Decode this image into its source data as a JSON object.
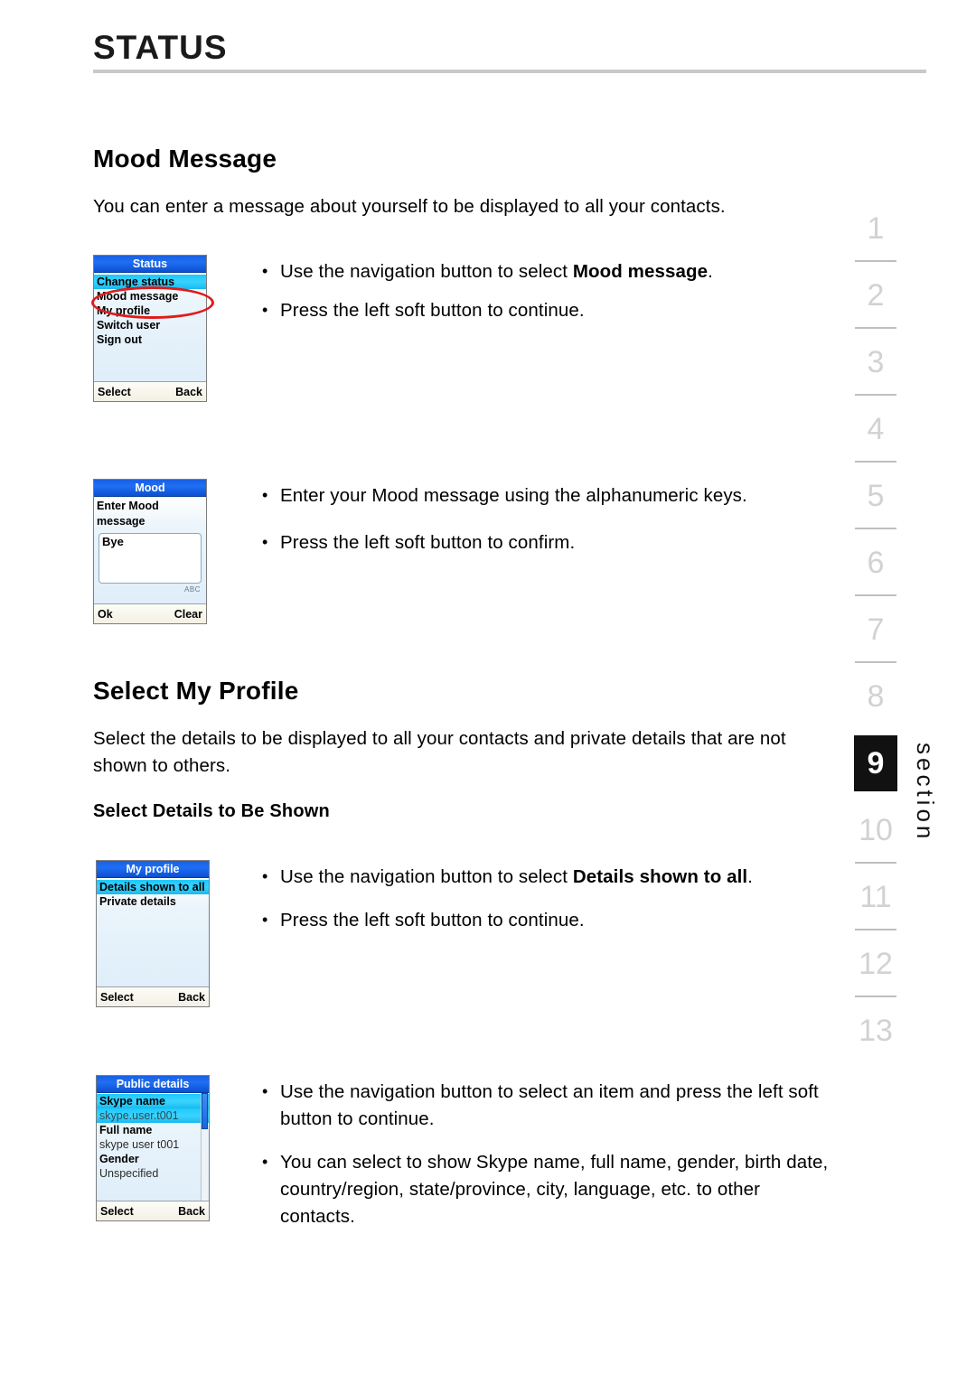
{
  "header": {
    "title": "STATUS"
  },
  "sections": [
    {
      "heading": "Mood Message",
      "intro": "You can enter a message about yourself to be displayed to all your contacts."
    },
    {
      "heading": "Select My Profile",
      "intro": "Select the details to be displayed to all your contacts and private details that are not shown to others.",
      "subheading": "Select Details to Be Shown"
    }
  ],
  "bullets": {
    "group1": [
      {
        "pre": "Use the navigation button to select ",
        "bold": "Mood message",
        "post": "."
      },
      {
        "pre": "Press the left soft button to continue.",
        "bold": "",
        "post": ""
      }
    ],
    "group2": [
      {
        "pre": "Enter your Mood message using the alphanumeric keys.",
        "bold": "",
        "post": ""
      },
      {
        "pre": "Press the left soft button to confirm.",
        "bold": "",
        "post": ""
      }
    ],
    "group3": [
      {
        "pre": "Use the navigation button to select ",
        "bold": "Details shown to all",
        "post": "."
      },
      {
        "pre": "Press the left soft button to continue.",
        "bold": "",
        "post": ""
      }
    ],
    "group4": [
      {
        "pre": "Use the navigation button to select an item and press the left soft button to continue.",
        "bold": "",
        "post": ""
      },
      {
        "pre": "You can select to show Skype name, full name, gender, birth date, country/region, state/province, city, language, etc. to other contacts.",
        "bold": "",
        "post": ""
      }
    ]
  },
  "phones": {
    "status": {
      "title": "Status",
      "items": [
        "Change status",
        "Mood message",
        "My profile",
        "Switch user",
        "Sign out"
      ],
      "selected_index": 0,
      "annotated_index": 1,
      "softkeys": {
        "left": "Select",
        "right": "Back"
      }
    },
    "mood": {
      "title": "Mood",
      "prompt": "Enter Mood message",
      "input_value": "Bye",
      "input_mode": "ABC",
      "softkeys": {
        "left": "Ok",
        "right": "Clear"
      }
    },
    "myprofile": {
      "title": "My profile",
      "items": [
        "Details shown to all",
        "Private details"
      ],
      "selected_index": 0,
      "softkeys": {
        "left": "Select",
        "right": "Back"
      }
    },
    "publicdetails": {
      "title": "Public details",
      "rows": [
        {
          "label": "Skype name",
          "value": "skype.user.t001"
        },
        {
          "label": "Full name",
          "value": "skype user t001"
        },
        {
          "label": "Gender",
          "value": "Unspecified"
        }
      ],
      "selected_index": 0,
      "softkeys": {
        "left": "Select",
        "right": "Back"
      }
    }
  },
  "section_index": {
    "numbers": [
      "1",
      "2",
      "3",
      "4",
      "5",
      "6",
      "7",
      "8",
      "9",
      "10",
      "11",
      "12",
      "13"
    ],
    "active": "9",
    "label": "section"
  },
  "colors": {
    "titlebar_blue": "#1f6ff5",
    "highlight_cyan": "#38d2fd",
    "annotation_red": "#e01b1b",
    "index_gray": "#d2d2d2",
    "rule_gray": "#c9c9c9"
  }
}
